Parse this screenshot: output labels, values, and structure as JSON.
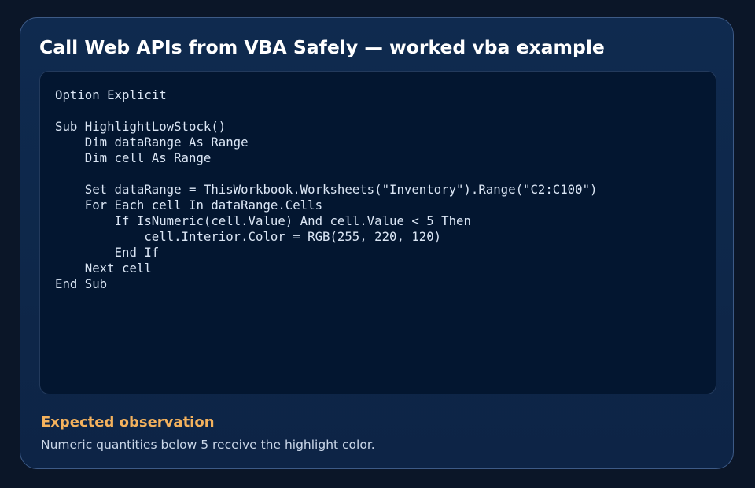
{
  "card": {
    "title": "Call Web APIs from VBA Safely — worked vba example",
    "code": {
      "language": "vba",
      "text": "Option Explicit\n\nSub HighlightLowStock()\n    Dim dataRange As Range\n    Dim cell As Range\n\n    Set dataRange = ThisWorkbook.Worksheets(\"Inventory\").Range(\"C2:C100\")\n    For Each cell In dataRange.Cells\n        If IsNumeric(cell.Value) And cell.Value < 5 Then\n            cell.Interior.Color = RGB(255, 220, 120)\n        End If\n    Next cell\nEnd Sub"
    },
    "observation": {
      "heading": "Expected observation",
      "text": "Numeric quantities below 5 receive the highlight color."
    }
  },
  "colors": {
    "page_background": "#0b1628",
    "card_background": "#0f2a4f",
    "card_border": "#3d5a86",
    "code_background": "#031630",
    "code_text": "#dbe6f5",
    "title": "#ffffff",
    "observation_heading": "#f4b25d",
    "observation_text": "#c9d6e8"
  }
}
